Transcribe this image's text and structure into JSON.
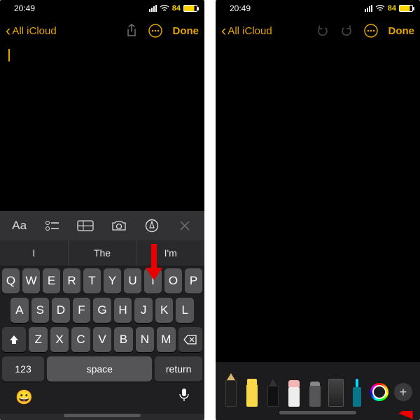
{
  "status": {
    "time": "20:49",
    "battery": "84"
  },
  "nav": {
    "back_label": "All iCloud",
    "done": "Done"
  },
  "keyboard": {
    "toolbar": {
      "aa": "Aa"
    },
    "suggestions": [
      "I",
      "The",
      "I'm"
    ],
    "row1": [
      "Q",
      "W",
      "E",
      "R",
      "T",
      "Y",
      "U",
      "I",
      "O",
      "P"
    ],
    "row2": [
      "A",
      "S",
      "D",
      "F",
      "G",
      "H",
      "J",
      "K",
      "L"
    ],
    "row3": [
      "Z",
      "X",
      "C",
      "V",
      "B",
      "N",
      "M"
    ],
    "numkey": "123",
    "space": "space",
    "return": "return",
    "emoji": "😀",
    "mic": "🎤"
  },
  "markup": {
    "tools": [
      "pen",
      "marker",
      "pencil",
      "eraser",
      "lasso",
      "ruler",
      "brush"
    ],
    "plus": "+"
  }
}
